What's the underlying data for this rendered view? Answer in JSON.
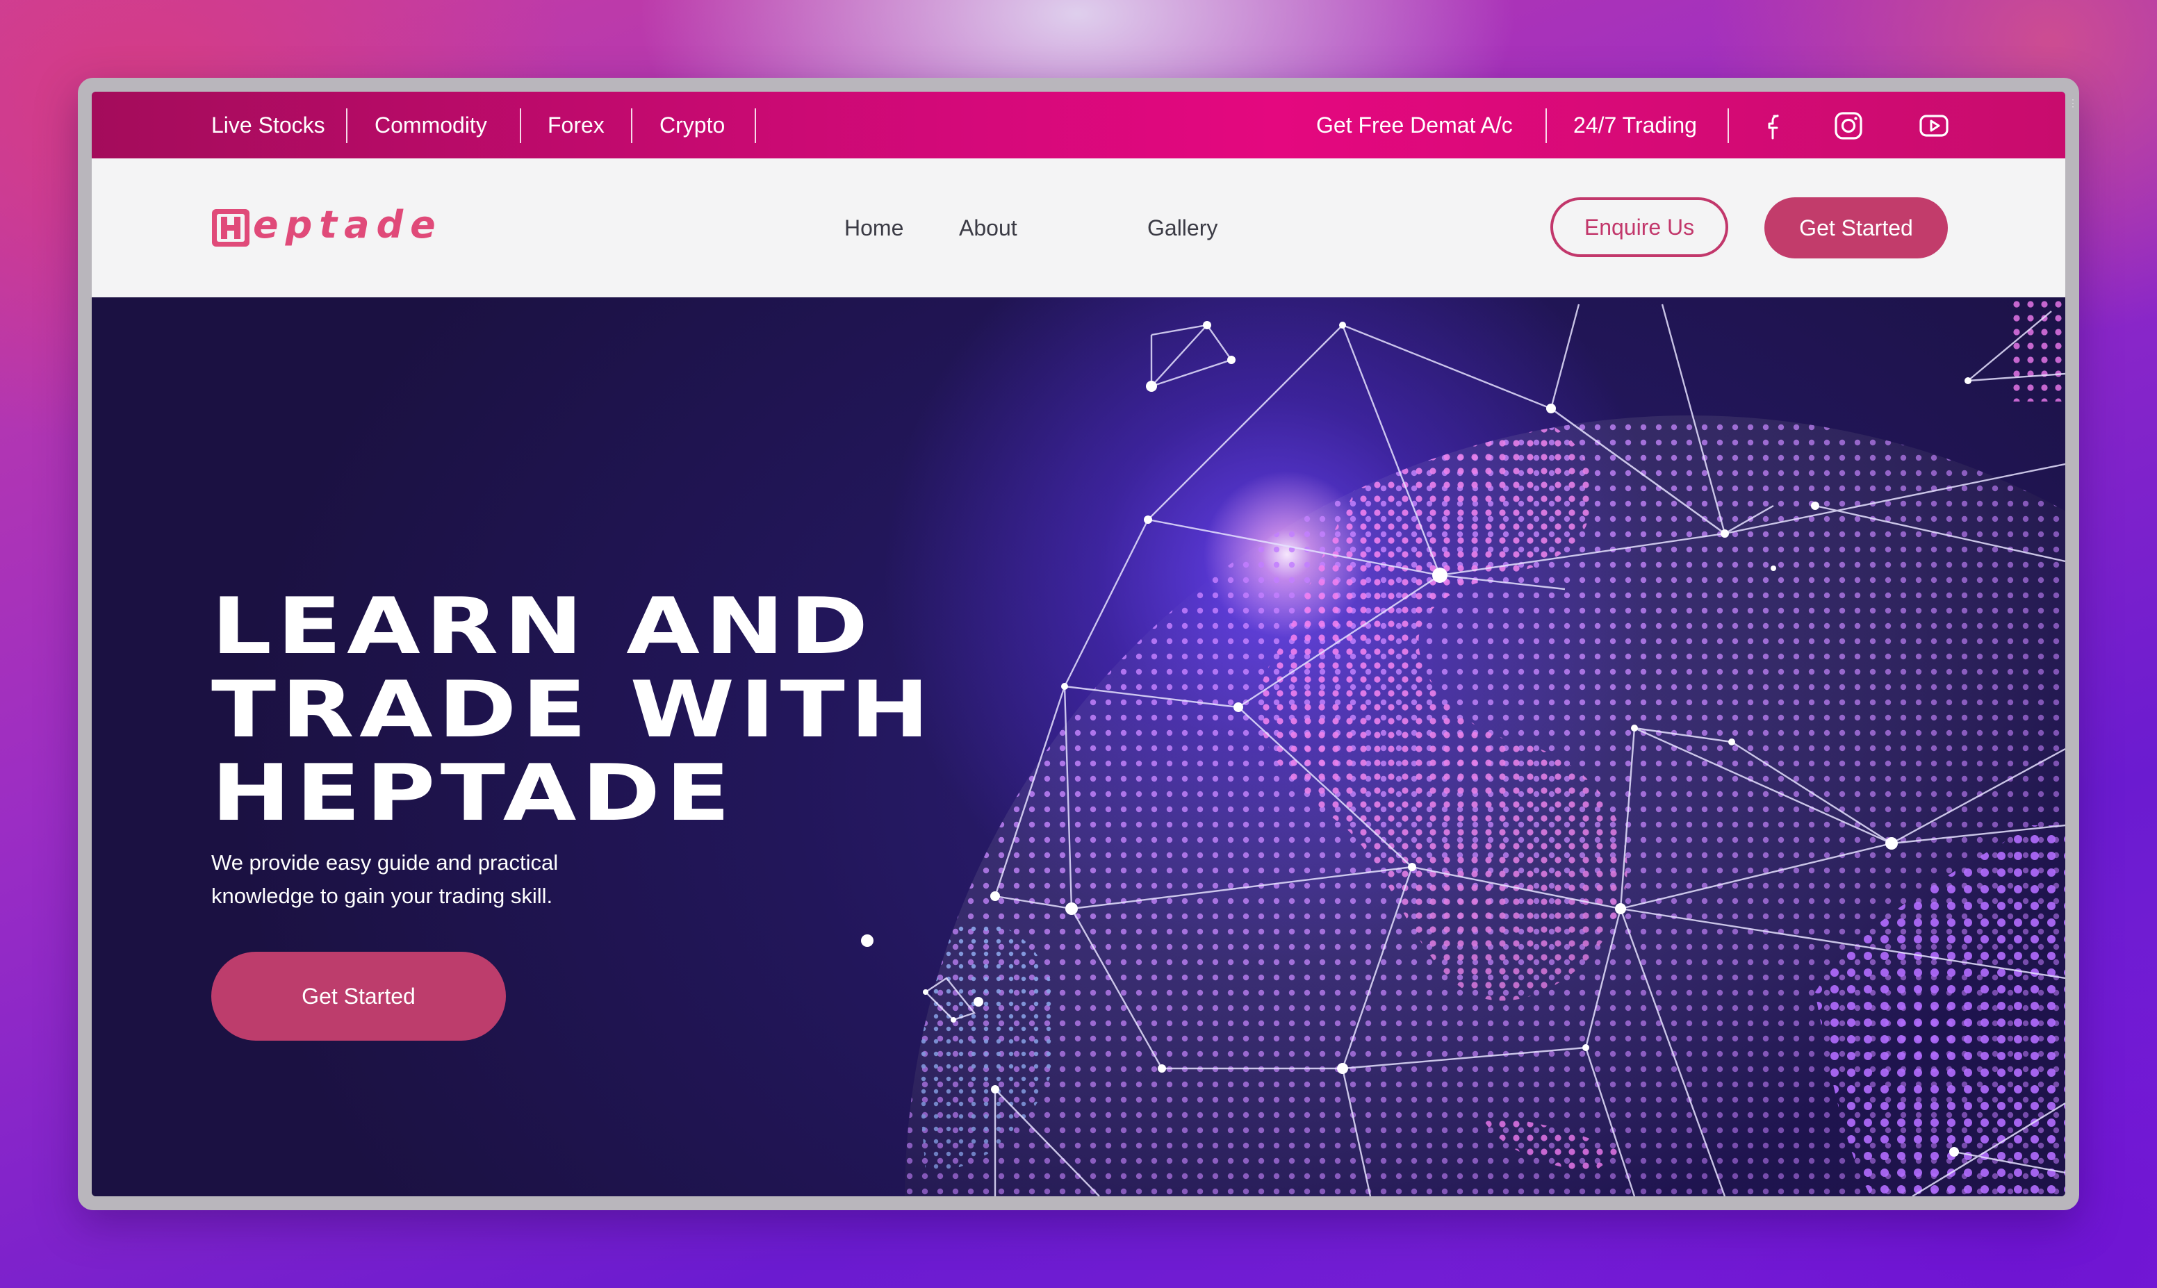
{
  "topbar": {
    "left_links": [
      {
        "label": "Live Stocks"
      },
      {
        "label": "Commodity"
      },
      {
        "label": "Forex"
      },
      {
        "label": "Crypto"
      }
    ],
    "right_links": [
      {
        "label": "Get Free Demat A/c"
      },
      {
        "label": "24/7 Trading"
      }
    ],
    "social_icons": [
      "facebook-icon",
      "instagram-icon",
      "youtube-icon"
    ]
  },
  "nav": {
    "logo_text": "eptade",
    "logo_letter": "H",
    "links": [
      {
        "label": "Home"
      },
      {
        "label": "About"
      },
      {
        "label": "Gallery"
      }
    ],
    "enquire_label": "Enquire Us",
    "get_started_label": "Get Started"
  },
  "hero": {
    "title_lines": [
      "LEARN AND",
      "TRADE WITH",
      "HEPTADE"
    ],
    "subtitle_line1": "We provide easy guide and practical",
    "subtitle_line2": "knowledge to gain your trading skill.",
    "cta_label": "Get Started"
  },
  "colors": {
    "topbar": "#d5097a",
    "accent": "#c23c6b",
    "logo": "#e04a79",
    "hero_bg": "#22165a"
  }
}
